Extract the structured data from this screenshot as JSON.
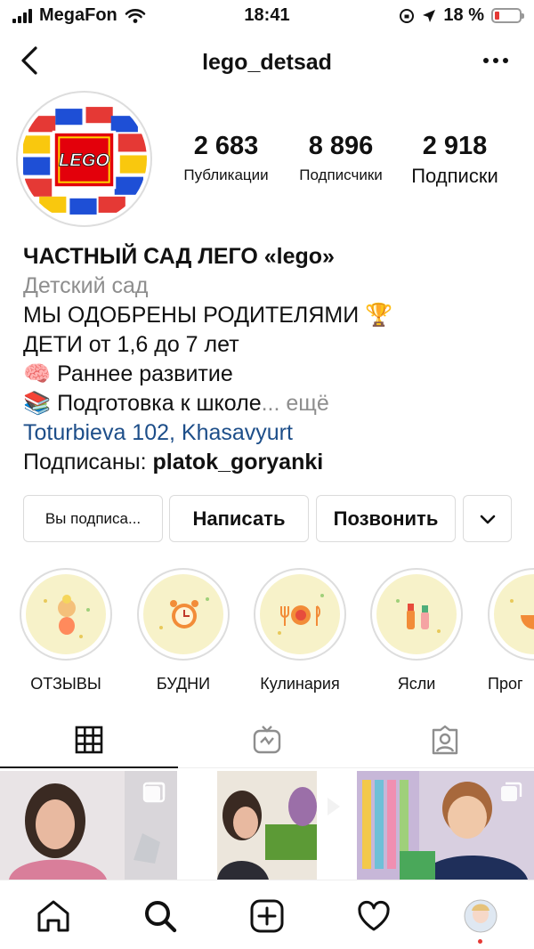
{
  "status_bar": {
    "carrier": "MegaFon",
    "time": "18:41",
    "battery": "18 %"
  },
  "header": {
    "username": "lego_detsad"
  },
  "profile": {
    "avatar_text": "LEGO",
    "stats": [
      {
        "value": "2 683",
        "label": "Публикации"
      },
      {
        "value": "8 896",
        "label": "Подписчики"
      },
      {
        "value": "2 918",
        "label": "Подписки"
      }
    ]
  },
  "bio": {
    "name": "ЧАСТНЫЙ САД ЛЕГО «lego»",
    "category": "Детский сад",
    "line1": "МЫ ОДОБРЕНЫ РОДИТЕЛЯМИ 🏆",
    "line2": "ДЕТИ от 1,6 до 7 лет",
    "line3": "🧠 Раннее развитие",
    "line4": "📚 Подготовка к школе",
    "more": "... ещё",
    "location": "Toturbieva 102, Khasavyurt",
    "followed_by_prefix": "Подписаны: ",
    "followed_by_user": "platok_goryanki"
  },
  "actions": {
    "following": "Вы подписа...",
    "message": "Написать",
    "call": "Позвонить"
  },
  "highlights": [
    {
      "label": "ОТЗЫВЫ"
    },
    {
      "label": "БУДНИ"
    },
    {
      "label": "Кулинария"
    },
    {
      "label": "Ясли"
    },
    {
      "label": "Прог"
    }
  ],
  "tabs": [
    "grid-icon",
    "igtv-icon",
    "tagged-icon"
  ],
  "colors": {
    "link": "#1d4e89",
    "secondary_text": "#8e8e8e",
    "highlight_bg": "#f7f2c9",
    "battery_low": "#e53935"
  }
}
